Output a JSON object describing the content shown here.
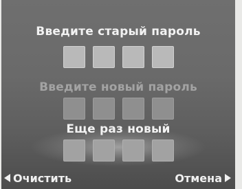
{
  "prompts": {
    "old_password": "Введите старый пароль",
    "new_password": "Введите новый пароль",
    "repeat_new": "Еще раз новый"
  },
  "pin_length": 4,
  "softkeys": {
    "left": "Очистить",
    "right": "Отмена"
  },
  "icons": {
    "left": "arrow-left-icon",
    "right": "arrow-right-icon"
  }
}
